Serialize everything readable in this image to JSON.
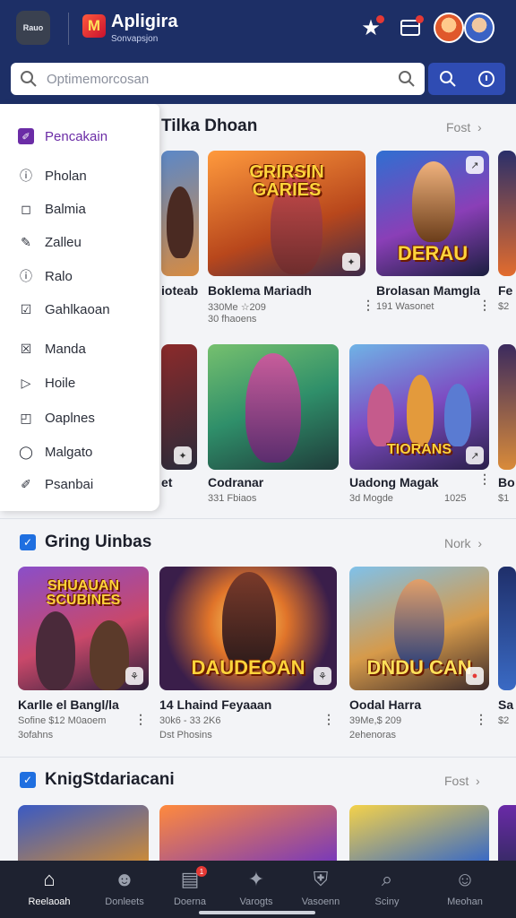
{
  "header": {
    "tile_label": "Rauo",
    "logo_glyph": "M",
    "app_name": "Apligira",
    "app_sub": "Sonvapsjon"
  },
  "search": {
    "placeholder": "Optimemorcosan"
  },
  "menu": {
    "items": [
      {
        "label": "Pencakain",
        "icon": "pencil-icon",
        "glyph": "✐"
      },
      {
        "label": "Pholan",
        "icon": "info-icon",
        "glyph": "ⓘ"
      },
      {
        "label": "Balmia",
        "icon": "square-icon",
        "glyph": "◻"
      },
      {
        "label": "Zalleu",
        "icon": "pen-icon",
        "glyph": "✎"
      },
      {
        "label": "Ralo",
        "icon": "info-icon",
        "glyph": "ⓘ"
      },
      {
        "label": "Gahlkaoan",
        "icon": "checkbox-icon",
        "glyph": "☑"
      },
      {
        "label": "Manda",
        "icon": "crossbox-icon",
        "glyph": "☒"
      },
      {
        "label": "Hoile",
        "icon": "play-icon",
        "glyph": "▷"
      },
      {
        "label": "Oaplnes",
        "icon": "frame-icon",
        "glyph": "◰"
      },
      {
        "label": "Malgato",
        "icon": "circle-icon",
        "glyph": "◯"
      },
      {
        "label": "Psanbai",
        "icon": "edit-icon",
        "glyph": "✐"
      }
    ]
  },
  "sections": [
    {
      "title": "Tilka Dhoan",
      "more": "Fost",
      "cards": [
        {
          "art": "",
          "title": "ioteab",
          "sub": "",
          "sub2": "",
          "badge": ""
        },
        {
          "art": "GRIRSIN GARIES",
          "title": "Boklema Mariadh",
          "sub": "330Me ☆209",
          "sub2": "30 fhaoens",
          "badge": "✦"
        },
        {
          "art": "DERAU",
          "title": "Brolasan Mamgla",
          "sub": "191 Wasonet",
          "sub2": "",
          "badge": "↗"
        },
        {
          "art": "",
          "title": "Fe",
          "sub": "$2",
          "sub2": "",
          "badge": ""
        }
      ]
    },
    {
      "title": "",
      "more": "",
      "cards": [
        {
          "art": "",
          "title": "et",
          "sub": "",
          "sub2": "",
          "badge": "✦"
        },
        {
          "art": "",
          "title": "Codranar",
          "sub": "331 Fbiaos",
          "sub2": "",
          "badge": ""
        },
        {
          "art": "TIORANS",
          "title": "Uadong Magak",
          "sub": "3d Mogde",
          "sub2": "1025",
          "badge": "↗"
        },
        {
          "art": "",
          "title": "Bo",
          "sub": "$1",
          "sub2": "",
          "badge": ""
        }
      ]
    },
    {
      "title": "Gring Uinbas",
      "more": "Nork",
      "cards": [
        {
          "art": "SHUAUAN SCUBINES",
          "title": "Karlle el Bangl/la",
          "sub": "Sofine $12 M0aoem",
          "sub2": "3ofahns",
          "badge": "⚘"
        },
        {
          "art": "DAUDEOAN",
          "title": "14 Lhaind Feyaaan",
          "sub": "30k6 - 33 2K6",
          "sub2": "Dst Phosins",
          "badge": "⚘"
        },
        {
          "art": "DNDU CAN",
          "title": "Oodal Harra",
          "sub": "39Me,$ 209",
          "sub2": "2ehenoras",
          "badge": "●"
        },
        {
          "art": "",
          "title": "Sa",
          "sub": "$2",
          "sub2": "",
          "badge": ""
        }
      ]
    },
    {
      "title": "KnigStdariacani",
      "more": "Fost",
      "cards": []
    }
  ],
  "tabs": [
    {
      "label": "Reelaoah",
      "icon": "home-icon",
      "glyph": "⌂",
      "active": true
    },
    {
      "label": "Donleets",
      "icon": "people-icon",
      "glyph": "☻",
      "active": false
    },
    {
      "label": "Doerna",
      "icon": "inbox-icon",
      "glyph": "▤",
      "active": false,
      "badge": "1"
    },
    {
      "label": "Varogts",
      "icon": "apps-icon",
      "glyph": "✦",
      "active": false
    },
    {
      "label": "Vasoenn",
      "icon": "shield-icon",
      "glyph": "⛨",
      "active": false
    },
    {
      "label": "Sciny",
      "icon": "search-icon",
      "glyph": "⌕",
      "active": false
    },
    {
      "label": "Meohan",
      "icon": "profile-icon",
      "glyph": "☺",
      "active": false
    }
  ]
}
